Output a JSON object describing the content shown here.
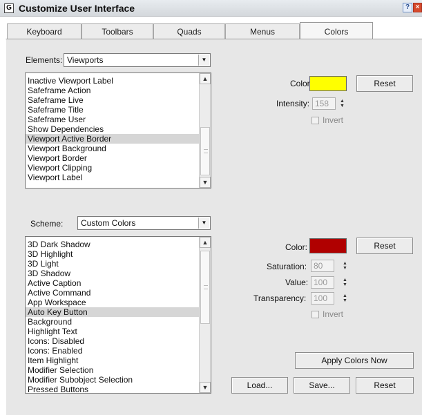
{
  "window": {
    "title": "Customize User Interface",
    "help_glyph": "?",
    "close_glyph": "×",
    "app_icon_glyph": "G"
  },
  "tabs": [
    {
      "label": "Keyboard"
    },
    {
      "label": "Toolbars"
    },
    {
      "label": "Quads"
    },
    {
      "label": "Menus"
    },
    {
      "label": "Colors",
      "active": true
    }
  ],
  "elements": {
    "label": "Elements:",
    "selected": "Viewports",
    "items": [
      "Inactive Viewport Label",
      "Safeframe Action",
      "Safeframe Live",
      "Safeframe Title",
      "Safeframe User",
      "Show Dependencies",
      "Viewport Active Border",
      "Viewport Background",
      "Viewport Border",
      "Viewport Clipping",
      "Viewport Label"
    ],
    "selected_item": "Viewport Active Border"
  },
  "element_color": {
    "color_label": "Color:",
    "color_hex": "#ffff00",
    "reset_label": "Reset",
    "intensity_label": "Intensity:",
    "intensity_value": "158",
    "invert_label": "Invert",
    "invert_checked": false
  },
  "scheme": {
    "label": "Scheme:",
    "selected": "Custom Colors",
    "items": [
      "3D Dark Shadow",
      "3D Highlight",
      "3D Light",
      "3D Shadow",
      "Active Caption",
      "Active Command",
      "App Workspace",
      "Auto Key Button",
      "Background",
      "Highlight Text",
      "Icons: Disabled",
      "Icons: Enabled",
      "Item Highlight",
      "Modifier Selection",
      "Modifier Subobject Selection",
      "Pressed Buttons"
    ],
    "selected_item": "Auto Key Button"
  },
  "scheme_color": {
    "color_label": "Color:",
    "color_hex": "#b00000",
    "reset_label": "Reset",
    "saturation_label": "Saturation:",
    "saturation_value": "80",
    "value_label": "Value:",
    "value_value": "100",
    "transparency_label": "Transparency:",
    "transparency_value": "100",
    "invert_label": "Invert",
    "invert_checked": false
  },
  "footer": {
    "apply_label": "Apply Colors Now",
    "load_label": "Load...",
    "save_label": "Save...",
    "reset_label": "Reset"
  }
}
